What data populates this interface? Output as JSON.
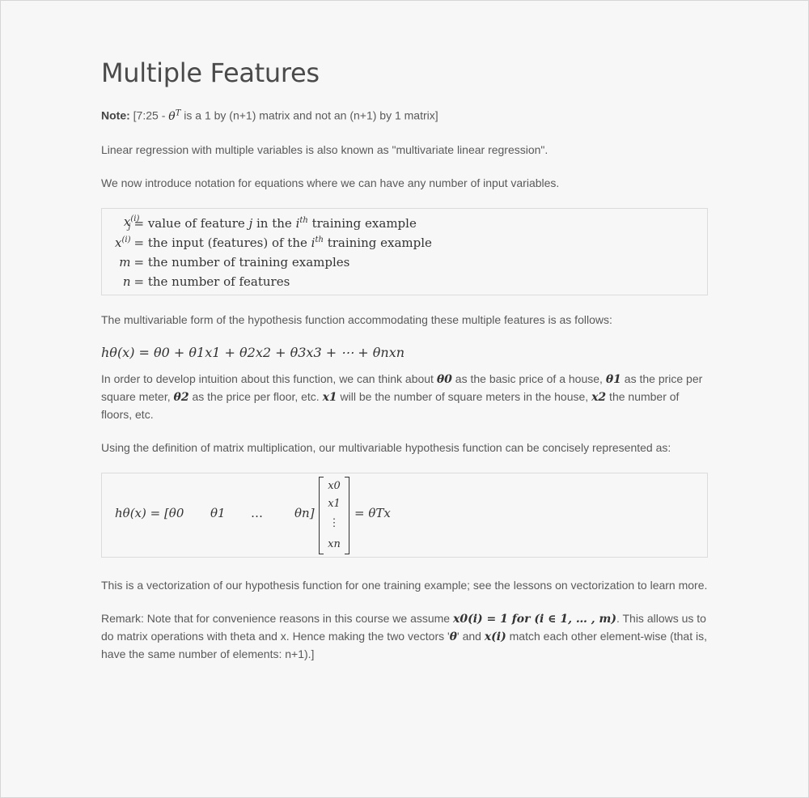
{
  "title": "Multiple Features",
  "note": {
    "label": "Note:",
    "pre": "[7:25 - ",
    "theta": "θ",
    "sup": "T",
    "post": " is a 1 by (n+1) matrix and not an (n+1) by 1 matrix]"
  },
  "intro1": "Linear regression with multiple variables is also known as \"multivariate linear regression\".",
  "intro2": "We now introduce notation for equations where we can have any number of input variables.",
  "definitions": [
    {
      "symbol": "x",
      "sup": "(i)",
      "sub": "j",
      "text_pre": "= value of feature ",
      "var": "j",
      "text_mid": " in the ",
      "var2": "i",
      "var2_sup": "th",
      "text_post": " training example"
    },
    {
      "symbol": "x",
      "sup": "(i)",
      "sub": "",
      "text_pre": "= the input (features) of the ",
      "var": "",
      "text_mid": "",
      "var2": "i",
      "var2_sup": "th",
      "text_post": " training example"
    },
    {
      "symbol": "m",
      "sup": "",
      "sub": "",
      "text_pre": "= the number of training examples",
      "var": "",
      "text_mid": "",
      "var2": "",
      "var2_sup": "",
      "text_post": ""
    },
    {
      "symbol": "n",
      "sup": "",
      "sub": "",
      "text_pre": "= the number of features",
      "var": "",
      "text_mid": "",
      "var2": "",
      "var2_sup": "",
      "text_post": ""
    }
  ],
  "multivariable_intro": "The multivariable form of the hypothesis function accommodating these multiple features is as follows:",
  "hypothesis": "hθ(x) = θ0 + θ1x1 + θ2x2 + θ3x3 + ⋯ + θnxn",
  "intuition": {
    "p1": "In order to develop intuition about this function, we can think about ",
    "t0": "θ0",
    "p2": " as the basic price of a house, ",
    "t1": "θ1",
    "p3": " as the price per square meter, ",
    "t2": "θ2",
    "p4": " as the price per floor, etc. ",
    "x1": "x1",
    "p5": " will be the number of square meters in the house, ",
    "x2": "x2",
    "p6": " the number of floors, etc."
  },
  "matrix_intro": "Using the definition of matrix multiplication, our multivariable hypothesis function can be concisely represented as:",
  "matrix": {
    "lhs": "hθ(x) = [θ0",
    "row": [
      "θ1",
      "…",
      "θn]"
    ],
    "vector": [
      "x0",
      "x1",
      "⋮",
      "xn"
    ],
    "rhs": "= θTx"
  },
  "vectorization": "This is a vectorization of our hypothesis function for one training example; see the lessons on vectorization to learn more.",
  "remark": {
    "p1": "Remark: Note that for convenience reasons in this course we assume ",
    "m1": "x0(i) = 1 for (i ∈ 1, … , m)",
    "p2": ". This allows us to do matrix operations with theta and x. Hence making the two vectors '",
    "m2": "θ",
    "p3": "' and ",
    "m3": "x(i)",
    "p4": " match each other element-wise (that is, have the same number of elements: n+1).]"
  }
}
